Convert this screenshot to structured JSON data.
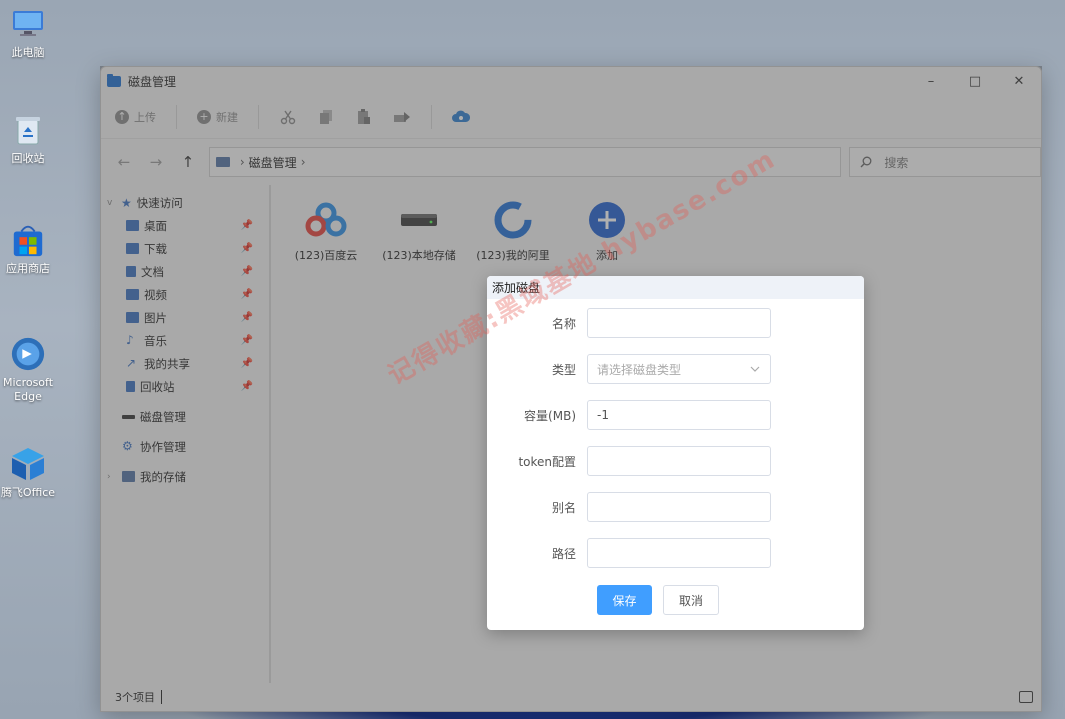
{
  "desktop": {
    "icons": [
      {
        "label": "此电脑",
        "icon": "computer-icon"
      },
      {
        "label": "回收站",
        "icon": "recycle-bin-icon"
      },
      {
        "label": "应用商店",
        "icon": "store-icon"
      },
      {
        "label": "Microsoft Edge",
        "icon": "edge-icon"
      },
      {
        "label": "腾飞Office",
        "icon": "office-icon"
      }
    ]
  },
  "window": {
    "title": "磁盘管理",
    "controls": {
      "minimize": "–",
      "maximize": "□",
      "close": "✕"
    }
  },
  "toolbar": {
    "upload_label": "上传",
    "new_label": "新建",
    "icons": [
      "cut-icon",
      "copy-icon",
      "paste-icon",
      "move-icon",
      "cloud-sync-icon"
    ]
  },
  "address": {
    "back": "←",
    "forward": "→",
    "up": "↑",
    "path": "磁盘管理",
    "search_placeholder": "搜索"
  },
  "sidebar": {
    "quick_access": "快速访问",
    "items": [
      {
        "label": "桌面",
        "icon": "desktop-icon",
        "color": "#3a6fc0"
      },
      {
        "label": "下载",
        "icon": "download-icon",
        "color": "#3a6fc0"
      },
      {
        "label": "文档",
        "icon": "document-icon",
        "color": "#3a6fc0"
      },
      {
        "label": "视频",
        "icon": "video-icon",
        "color": "#3a6fc0"
      },
      {
        "label": "图片",
        "icon": "picture-icon",
        "color": "#3a6fc0"
      },
      {
        "label": "音乐",
        "icon": "music-icon",
        "color": "#3a6fc0"
      },
      {
        "label": "我的共享",
        "icon": "share-icon",
        "color": "#3a6fc0"
      },
      {
        "label": "回收站",
        "icon": "recycle-bin-icon",
        "color": "#3a6fc0"
      }
    ],
    "disk_manage": "磁盘管理",
    "collab_manage": "协作管理",
    "my_storage": "我的存储"
  },
  "files": [
    {
      "label": "(123)百度云",
      "icon": "baidu-cloud-icon"
    },
    {
      "label": "(123)本地存储",
      "icon": "hard-drive-icon"
    },
    {
      "label": "(123)我的阿里",
      "icon": "aliyun-drive-icon"
    },
    {
      "label": "添加",
      "icon": "add-icon"
    }
  ],
  "status": {
    "item_count": "3个项目"
  },
  "dialog": {
    "title": "添加磁盘",
    "fields": {
      "name": {
        "label": "名称",
        "value": ""
      },
      "type": {
        "label": "类型",
        "placeholder": "请选择磁盘类型"
      },
      "capacity": {
        "label": "容量(MB)",
        "value": "-1"
      },
      "token": {
        "label": "token配置",
        "value": ""
      },
      "alias": {
        "label": "别名",
        "value": ""
      },
      "path": {
        "label": "路径",
        "value": ""
      }
    },
    "save_label": "保存",
    "cancel_label": "取消"
  },
  "watermark": "记得收藏:黑域基地 hybase.com",
  "colors": {
    "accent": "#409eff",
    "folder": "#1d6fd1"
  }
}
